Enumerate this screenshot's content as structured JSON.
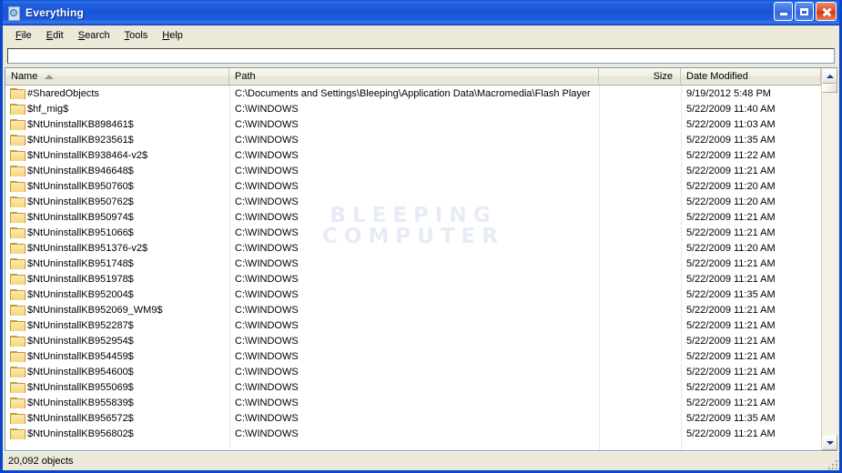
{
  "window": {
    "title": "Everything",
    "icon": "everything-app-icon",
    "minimize_label": "Minimize",
    "maximize_label": "Maximize",
    "close_label": "Close"
  },
  "menu": {
    "items": [
      {
        "label": "File",
        "accel": "F"
      },
      {
        "label": "Edit",
        "accel": "E"
      },
      {
        "label": "Search",
        "accel": "S"
      },
      {
        "label": "Tools",
        "accel": "T"
      },
      {
        "label": "Help",
        "accel": "H"
      }
    ]
  },
  "search": {
    "value": "",
    "placeholder": ""
  },
  "watermark": {
    "line1": "BLEEPING",
    "line2": "COMPUTER",
    "color": "#e6ecf5"
  },
  "list": {
    "columns": [
      {
        "key": "name",
        "label": "Name",
        "sort": "ascending"
      },
      {
        "key": "path",
        "label": "Path",
        "sort": ""
      },
      {
        "key": "size",
        "label": "Size",
        "sort": ""
      },
      {
        "key": "date",
        "label": "Date Modified",
        "sort": ""
      }
    ],
    "rows": [
      {
        "icon": "folder-icon",
        "name": "#SharedObjects",
        "path": "C:\\Documents and Settings\\Bleeping\\Application Data\\Macromedia\\Flash Player",
        "size": "",
        "date": "9/19/2012 5:48 PM"
      },
      {
        "icon": "folder-icon",
        "name": "$hf_mig$",
        "path": "C:\\WINDOWS",
        "size": "",
        "date": "5/22/2009 11:40 AM"
      },
      {
        "icon": "folder-icon",
        "name": "$NtUninstallKB898461$",
        "path": "C:\\WINDOWS",
        "size": "",
        "date": "5/22/2009 11:03 AM"
      },
      {
        "icon": "folder-icon",
        "name": "$NtUninstallKB923561$",
        "path": "C:\\WINDOWS",
        "size": "",
        "date": "5/22/2009 11:35 AM"
      },
      {
        "icon": "folder-icon",
        "name": "$NtUninstallKB938464-v2$",
        "path": "C:\\WINDOWS",
        "size": "",
        "date": "5/22/2009 11:22 AM"
      },
      {
        "icon": "folder-icon",
        "name": "$NtUninstallKB946648$",
        "path": "C:\\WINDOWS",
        "size": "",
        "date": "5/22/2009 11:21 AM"
      },
      {
        "icon": "folder-icon",
        "name": "$NtUninstallKB950760$",
        "path": "C:\\WINDOWS",
        "size": "",
        "date": "5/22/2009 11:20 AM"
      },
      {
        "icon": "folder-icon",
        "name": "$NtUninstallKB950762$",
        "path": "C:\\WINDOWS",
        "size": "",
        "date": "5/22/2009 11:20 AM"
      },
      {
        "icon": "folder-icon",
        "name": "$NtUninstallKB950974$",
        "path": "C:\\WINDOWS",
        "size": "",
        "date": "5/22/2009 11:21 AM"
      },
      {
        "icon": "folder-icon",
        "name": "$NtUninstallKB951066$",
        "path": "C:\\WINDOWS",
        "size": "",
        "date": "5/22/2009 11:21 AM"
      },
      {
        "icon": "folder-icon",
        "name": "$NtUninstallKB951376-v2$",
        "path": "C:\\WINDOWS",
        "size": "",
        "date": "5/22/2009 11:20 AM"
      },
      {
        "icon": "folder-icon",
        "name": "$NtUninstallKB951748$",
        "path": "C:\\WINDOWS",
        "size": "",
        "date": "5/22/2009 11:21 AM"
      },
      {
        "icon": "folder-icon",
        "name": "$NtUninstallKB951978$",
        "path": "C:\\WINDOWS",
        "size": "",
        "date": "5/22/2009 11:21 AM"
      },
      {
        "icon": "folder-icon",
        "name": "$NtUninstallKB952004$",
        "path": "C:\\WINDOWS",
        "size": "",
        "date": "5/22/2009 11:35 AM"
      },
      {
        "icon": "folder-icon",
        "name": "$NtUninstallKB952069_WM9$",
        "path": "C:\\WINDOWS",
        "size": "",
        "date": "5/22/2009 11:21 AM"
      },
      {
        "icon": "folder-icon",
        "name": "$NtUninstallKB952287$",
        "path": "C:\\WINDOWS",
        "size": "",
        "date": "5/22/2009 11:21 AM"
      },
      {
        "icon": "folder-icon",
        "name": "$NtUninstallKB952954$",
        "path": "C:\\WINDOWS",
        "size": "",
        "date": "5/22/2009 11:21 AM"
      },
      {
        "icon": "folder-icon",
        "name": "$NtUninstallKB954459$",
        "path": "C:\\WINDOWS",
        "size": "",
        "date": "5/22/2009 11:21 AM"
      },
      {
        "icon": "folder-icon",
        "name": "$NtUninstallKB954600$",
        "path": "C:\\WINDOWS",
        "size": "",
        "date": "5/22/2009 11:21 AM"
      },
      {
        "icon": "folder-icon",
        "name": "$NtUninstallKB955069$",
        "path": "C:\\WINDOWS",
        "size": "",
        "date": "5/22/2009 11:21 AM"
      },
      {
        "icon": "folder-icon",
        "name": "$NtUninstallKB955839$",
        "path": "C:\\WINDOWS",
        "size": "",
        "date": "5/22/2009 11:21 AM"
      },
      {
        "icon": "folder-icon",
        "name": "$NtUninstallKB956572$",
        "path": "C:\\WINDOWS",
        "size": "",
        "date": "5/22/2009 11:35 AM"
      },
      {
        "icon": "folder-icon",
        "name": "$NtUninstallKB956802$",
        "path": "C:\\WINDOWS",
        "size": "",
        "date": "5/22/2009 11:21 AM"
      }
    ]
  },
  "scrollbar": {
    "up_icon": "scroll-up-arrow-icon",
    "down_icon": "scroll-down-arrow-icon"
  },
  "status": {
    "text": "20,092 objects"
  }
}
